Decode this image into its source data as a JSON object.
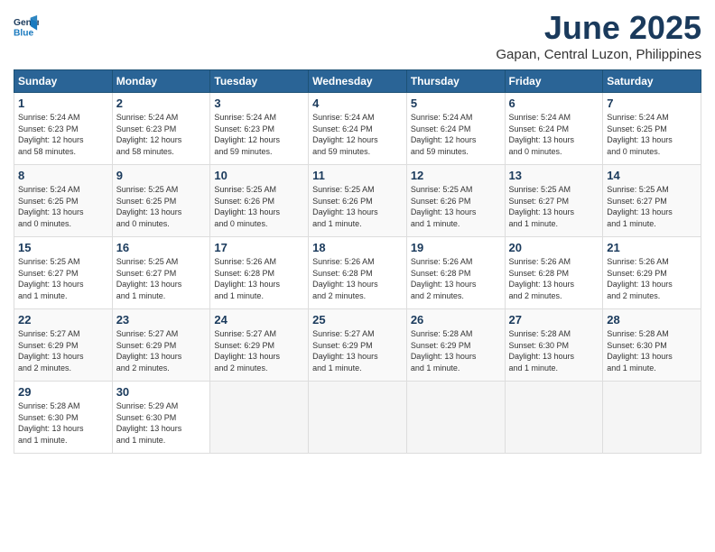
{
  "header": {
    "logo_line1": "General",
    "logo_line2": "Blue",
    "title": "June 2025",
    "subtitle": "Gapan, Central Luzon, Philippines"
  },
  "calendar": {
    "days_of_week": [
      "Sunday",
      "Monday",
      "Tuesday",
      "Wednesday",
      "Thursday",
      "Friday",
      "Saturday"
    ],
    "weeks": [
      [
        {
          "day": "",
          "info": ""
        },
        {
          "day": "2",
          "info": "Sunrise: 5:24 AM\nSunset: 6:23 PM\nDaylight: 12 hours\nand 58 minutes."
        },
        {
          "day": "3",
          "info": "Sunrise: 5:24 AM\nSunset: 6:23 PM\nDaylight: 12 hours\nand 59 minutes."
        },
        {
          "day": "4",
          "info": "Sunrise: 5:24 AM\nSunset: 6:24 PM\nDaylight: 12 hours\nand 59 minutes."
        },
        {
          "day": "5",
          "info": "Sunrise: 5:24 AM\nSunset: 6:24 PM\nDaylight: 12 hours\nand 59 minutes."
        },
        {
          "day": "6",
          "info": "Sunrise: 5:24 AM\nSunset: 6:24 PM\nDaylight: 13 hours\nand 0 minutes."
        },
        {
          "day": "7",
          "info": "Sunrise: 5:24 AM\nSunset: 6:25 PM\nDaylight: 13 hours\nand 0 minutes."
        }
      ],
      [
        {
          "day": "1",
          "info": "Sunrise: 5:24 AM\nSunset: 6:23 PM\nDaylight: 12 hours\nand 58 minutes."
        },
        null,
        null,
        null,
        null,
        null,
        null
      ],
      [
        {
          "day": "8",
          "info": "Sunrise: 5:24 AM\nSunset: 6:25 PM\nDaylight: 13 hours\nand 0 minutes."
        },
        {
          "day": "9",
          "info": "Sunrise: 5:25 AM\nSunset: 6:25 PM\nDaylight: 13 hours\nand 0 minutes."
        },
        {
          "day": "10",
          "info": "Sunrise: 5:25 AM\nSunset: 6:26 PM\nDaylight: 13 hours\nand 0 minutes."
        },
        {
          "day": "11",
          "info": "Sunrise: 5:25 AM\nSunset: 6:26 PM\nDaylight: 13 hours\nand 1 minute."
        },
        {
          "day": "12",
          "info": "Sunrise: 5:25 AM\nSunset: 6:26 PM\nDaylight: 13 hours\nand 1 minute."
        },
        {
          "day": "13",
          "info": "Sunrise: 5:25 AM\nSunset: 6:27 PM\nDaylight: 13 hours\nand 1 minute."
        },
        {
          "day": "14",
          "info": "Sunrise: 5:25 AM\nSunset: 6:27 PM\nDaylight: 13 hours\nand 1 minute."
        }
      ],
      [
        {
          "day": "15",
          "info": "Sunrise: 5:25 AM\nSunset: 6:27 PM\nDaylight: 13 hours\nand 1 minute."
        },
        {
          "day": "16",
          "info": "Sunrise: 5:25 AM\nSunset: 6:27 PM\nDaylight: 13 hours\nand 1 minute."
        },
        {
          "day": "17",
          "info": "Sunrise: 5:26 AM\nSunset: 6:28 PM\nDaylight: 13 hours\nand 1 minute."
        },
        {
          "day": "18",
          "info": "Sunrise: 5:26 AM\nSunset: 6:28 PM\nDaylight: 13 hours\nand 2 minutes."
        },
        {
          "day": "19",
          "info": "Sunrise: 5:26 AM\nSunset: 6:28 PM\nDaylight: 13 hours\nand 2 minutes."
        },
        {
          "day": "20",
          "info": "Sunrise: 5:26 AM\nSunset: 6:28 PM\nDaylight: 13 hours\nand 2 minutes."
        },
        {
          "day": "21",
          "info": "Sunrise: 5:26 AM\nSunset: 6:29 PM\nDaylight: 13 hours\nand 2 minutes."
        }
      ],
      [
        {
          "day": "22",
          "info": "Sunrise: 5:27 AM\nSunset: 6:29 PM\nDaylight: 13 hours\nand 2 minutes."
        },
        {
          "day": "23",
          "info": "Sunrise: 5:27 AM\nSunset: 6:29 PM\nDaylight: 13 hours\nand 2 minutes."
        },
        {
          "day": "24",
          "info": "Sunrise: 5:27 AM\nSunset: 6:29 PM\nDaylight: 13 hours\nand 2 minutes."
        },
        {
          "day": "25",
          "info": "Sunrise: 5:27 AM\nSunset: 6:29 PM\nDaylight: 13 hours\nand 1 minute."
        },
        {
          "day": "26",
          "info": "Sunrise: 5:28 AM\nSunset: 6:29 PM\nDaylight: 13 hours\nand 1 minute."
        },
        {
          "day": "27",
          "info": "Sunrise: 5:28 AM\nSunset: 6:30 PM\nDaylight: 13 hours\nand 1 minute."
        },
        {
          "day": "28",
          "info": "Sunrise: 5:28 AM\nSunset: 6:30 PM\nDaylight: 13 hours\nand 1 minute."
        }
      ],
      [
        {
          "day": "29",
          "info": "Sunrise: 5:28 AM\nSunset: 6:30 PM\nDaylight: 13 hours\nand 1 minute."
        },
        {
          "day": "30",
          "info": "Sunrise: 5:29 AM\nSunset: 6:30 PM\nDaylight: 13 hours\nand 1 minute."
        },
        {
          "day": "",
          "info": ""
        },
        {
          "day": "",
          "info": ""
        },
        {
          "day": "",
          "info": ""
        },
        {
          "day": "",
          "info": ""
        },
        {
          "day": "",
          "info": ""
        }
      ]
    ]
  }
}
